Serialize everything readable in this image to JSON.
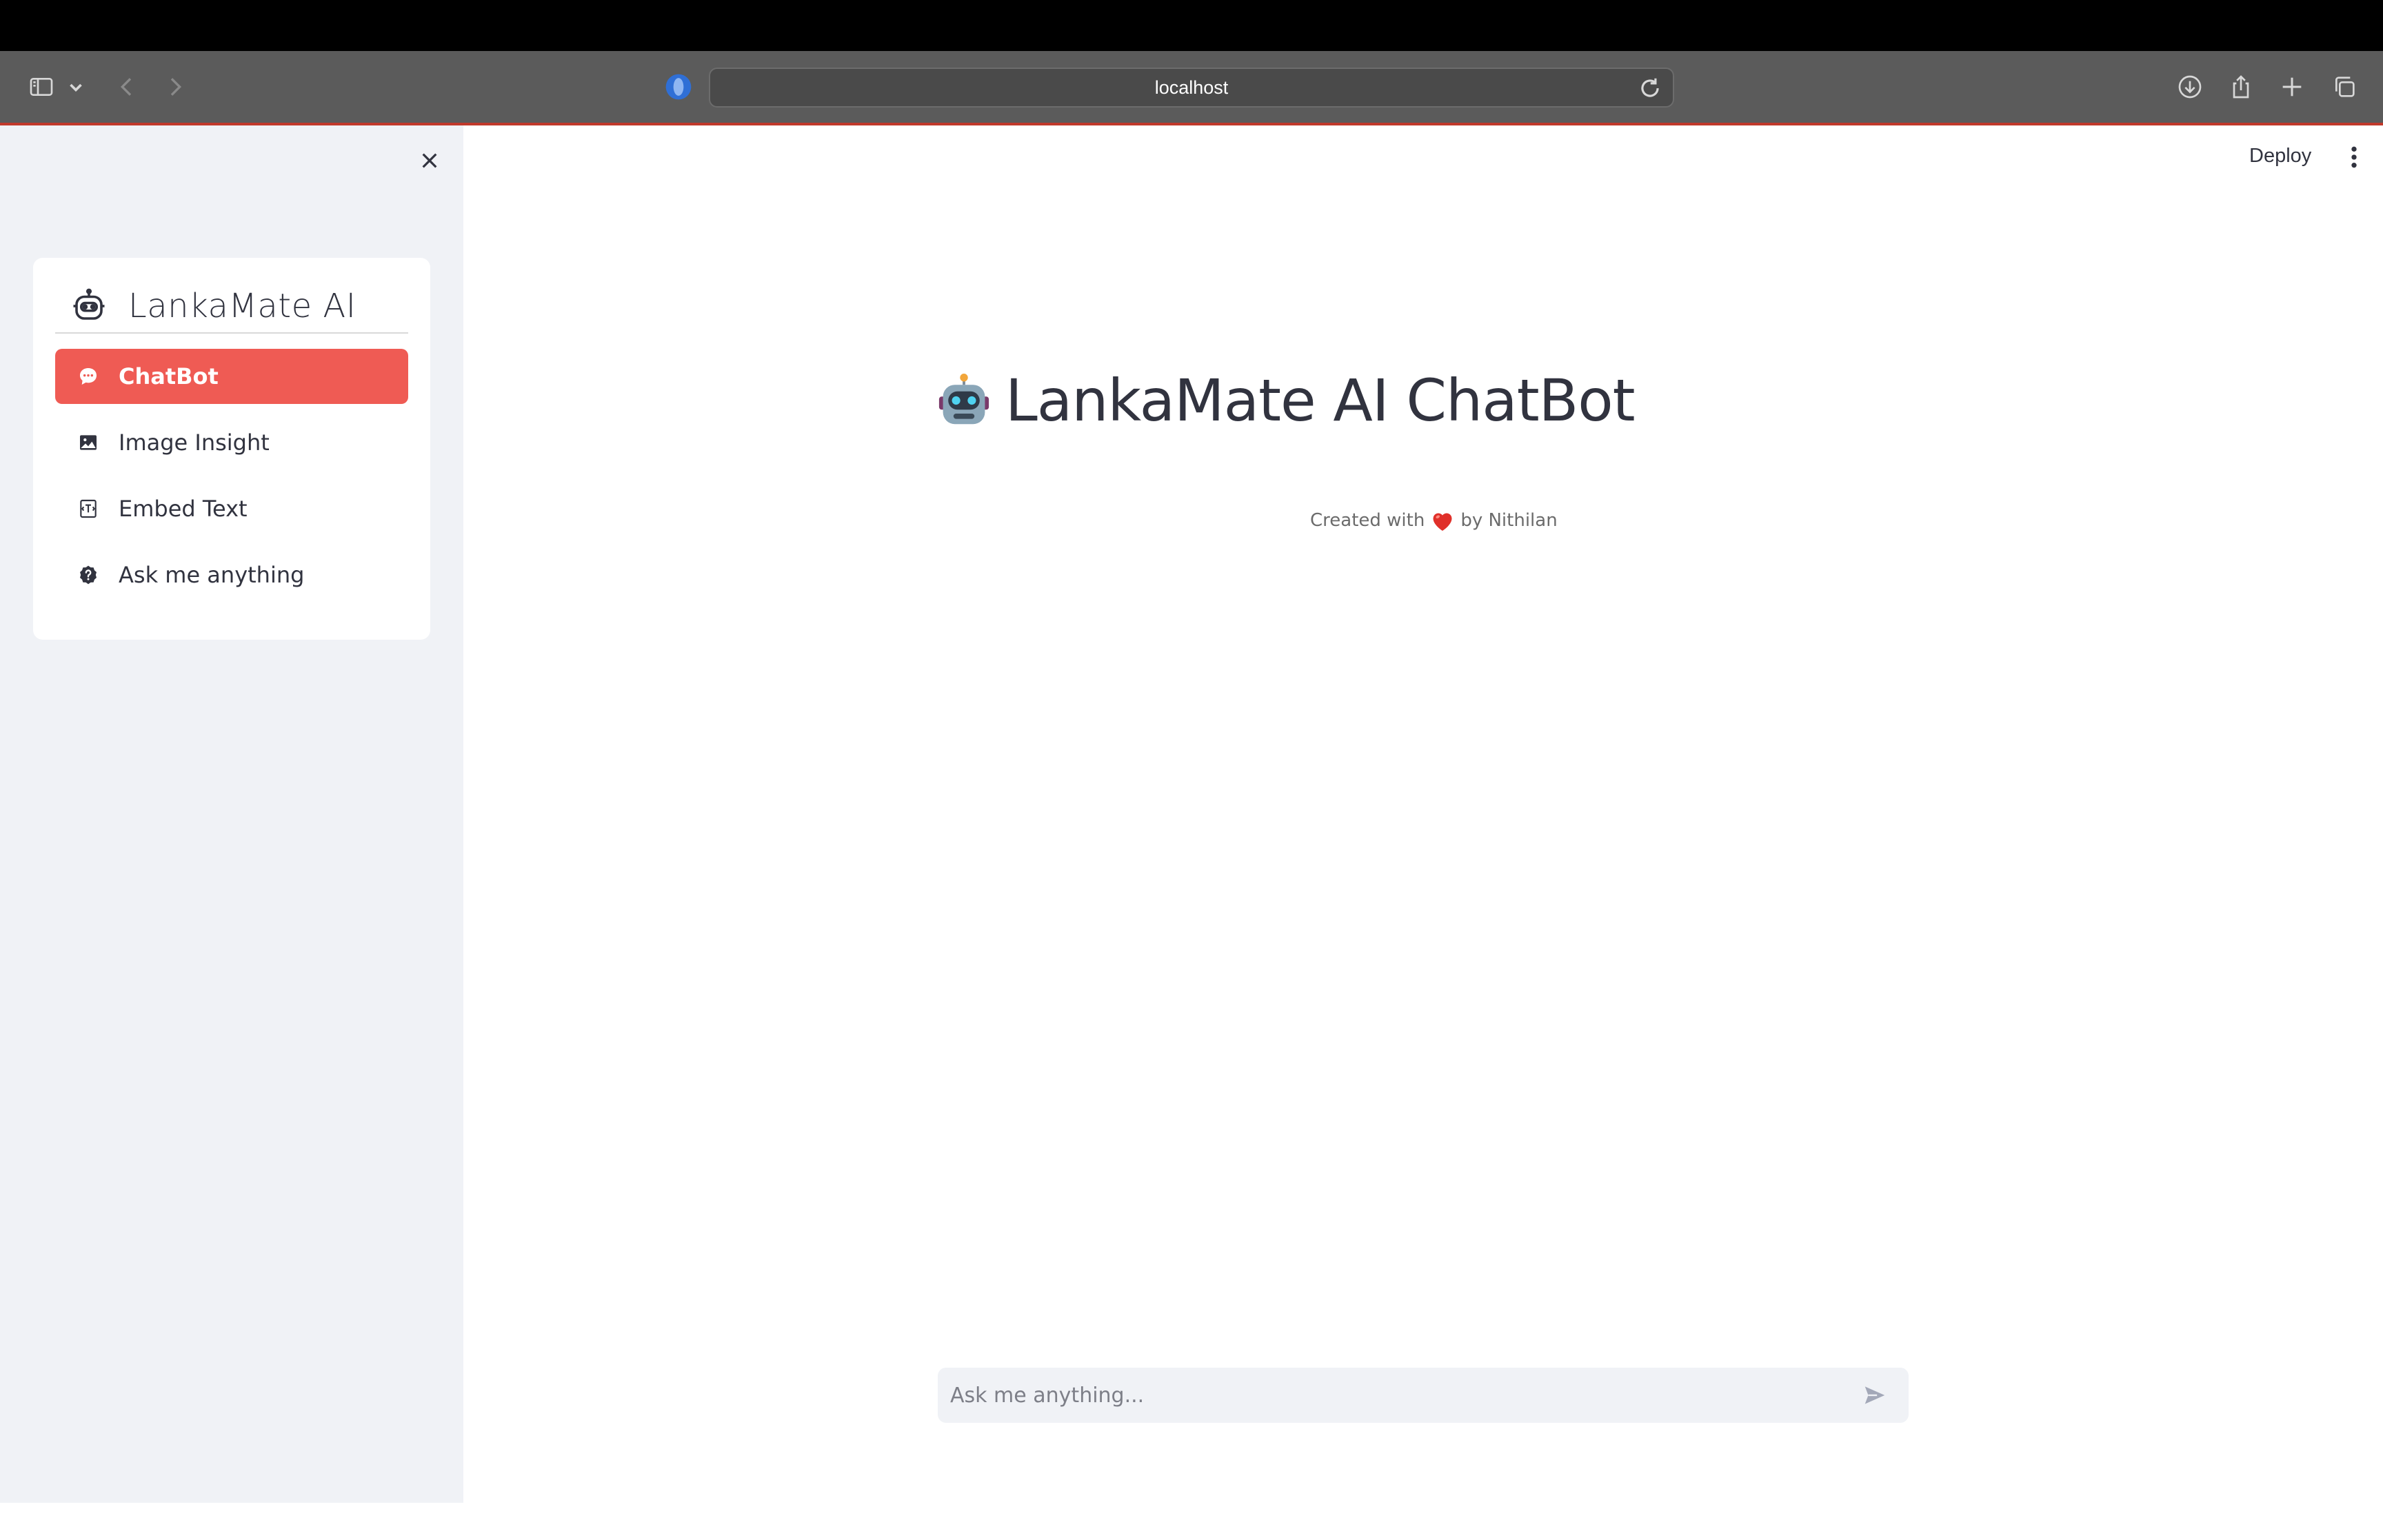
{
  "browser": {
    "url": "localhost"
  },
  "sidebar": {
    "title": "LankaMate AI",
    "items": [
      {
        "label": "ChatBot",
        "icon": "chat-bubble-icon",
        "active": true
      },
      {
        "label": "Image Insight",
        "icon": "image-icon",
        "active": false
      },
      {
        "label": "Embed Text",
        "icon": "embed-text-icon",
        "active": false
      },
      {
        "label": "Ask me anything",
        "icon": "question-circle-icon",
        "active": false
      }
    ]
  },
  "header": {
    "deploy_label": "Deploy"
  },
  "main": {
    "title": "LankaMate AI ChatBot",
    "credit_prefix": "Created with",
    "credit_suffix": "by Nithilan"
  },
  "chat": {
    "placeholder": "Ask me anything..."
  },
  "colors": {
    "accent": "#ef5b54",
    "sidebar_bg": "#f0f2f6",
    "text": "#31333f"
  }
}
